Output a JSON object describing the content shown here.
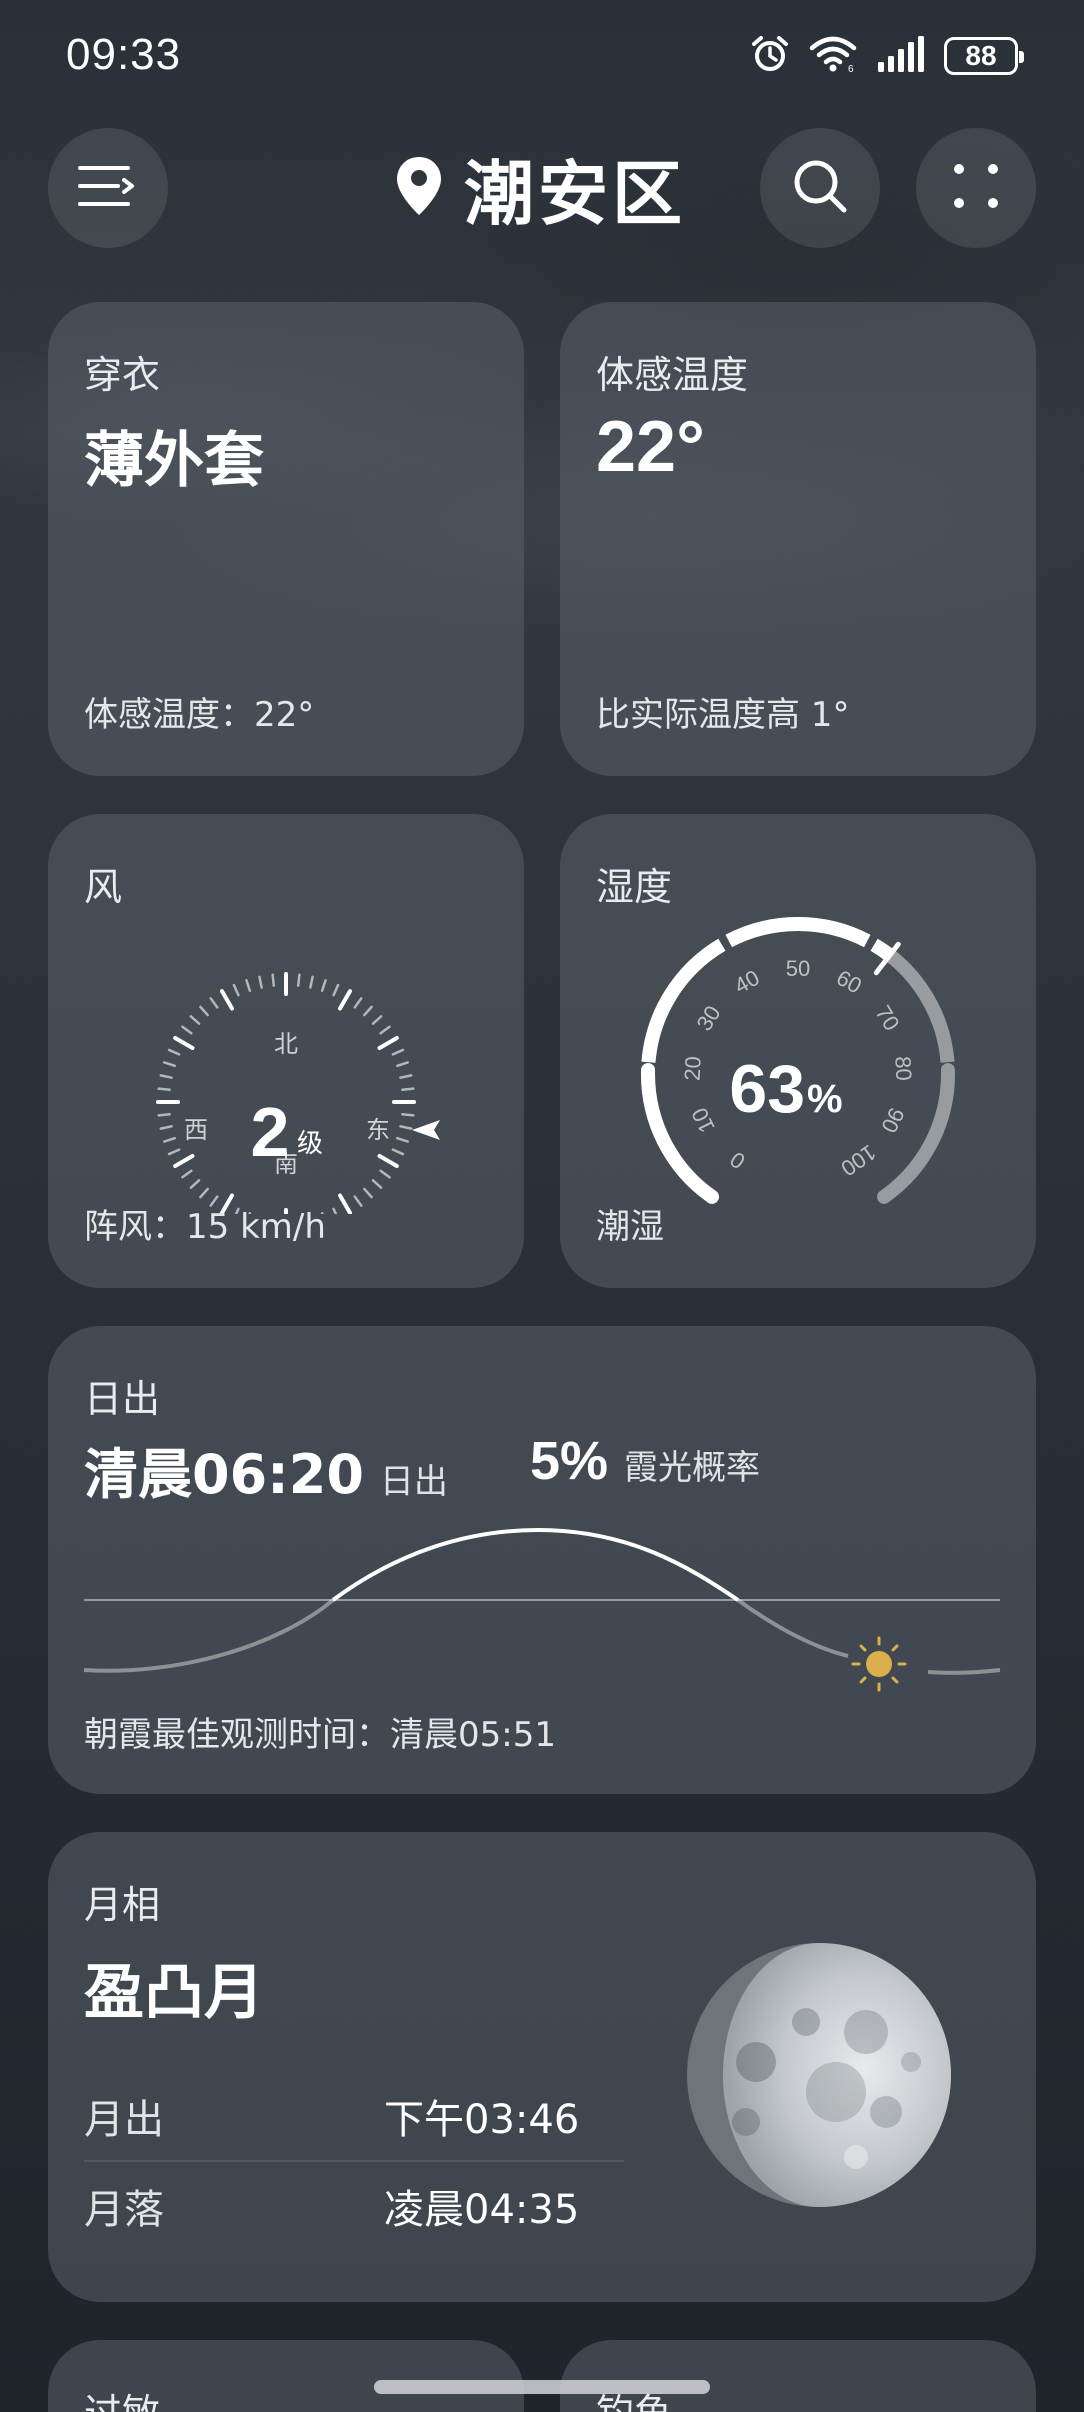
{
  "status_bar": {
    "time": "09:33",
    "battery": "88",
    "icons": [
      "alarm-icon",
      "wifi-icon",
      "signal-icon",
      "battery-icon"
    ]
  },
  "header": {
    "location": "潮安区",
    "icons": [
      "menu-icon",
      "location-pin-icon",
      "search-icon",
      "more-icon"
    ]
  },
  "clothing": {
    "label": "穿衣",
    "value": "薄外套",
    "footer": "体感温度：22°"
  },
  "feels_like": {
    "label": "体感温度",
    "value": "22°",
    "footer": "比实际温度高 1°"
  },
  "wind": {
    "label": "风",
    "level_value": "2",
    "level_unit": "级",
    "north": "北",
    "south": "南",
    "east": "东",
    "west": "西",
    "direction": "东",
    "footer": "阵风：15 km/h"
  },
  "humidity": {
    "label": "湿度",
    "value_number": "63",
    "value_unit": "%",
    "value": 63,
    "ticks": [
      "0",
      "10",
      "20",
      "30",
      "40",
      "50",
      "60",
      "70",
      "80",
      "90",
      "100"
    ],
    "footer": "潮湿"
  },
  "sunrise": {
    "label": "日出",
    "time": "清晨06:20",
    "time_sub": "日出",
    "glow_value": "5%",
    "glow_label": "霞光概率",
    "footer": "朝霞最佳观测时间：清晨05:51",
    "sun_color": "#d9b04c"
  },
  "moon": {
    "label": "月相",
    "phase": "盈凸月",
    "rise_label": "月出",
    "rise_time": "下午03:46",
    "set_label": "月落",
    "set_time": "凌晨04:35"
  },
  "bottom_cards": {
    "allergy": "过敏",
    "fishing": "钓鱼"
  }
}
